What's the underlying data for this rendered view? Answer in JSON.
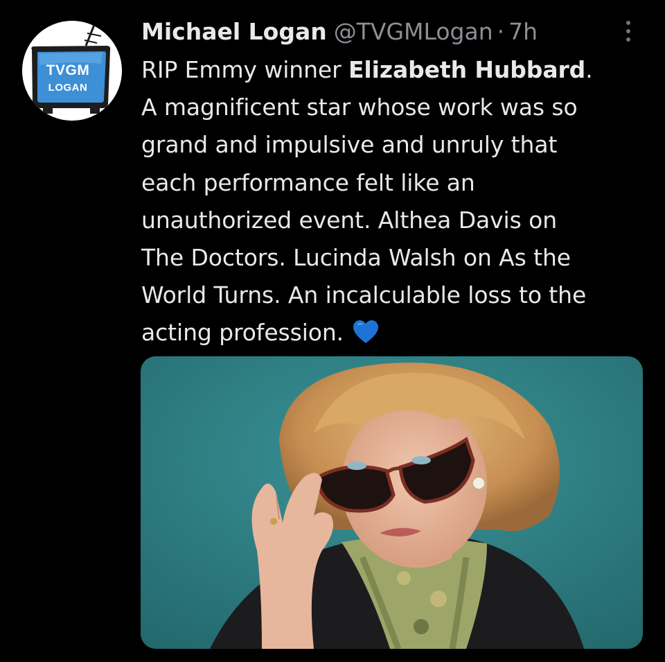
{
  "author": {
    "name": "Michael Logan",
    "handle": "@TVGMLogan",
    "separator": "·",
    "timestamp": "7h",
    "avatar_text_line1": "TVGM",
    "avatar_text_line2": "LOGAN"
  },
  "tweet": {
    "line1_prefix": "RIP Emmy winner ",
    "line1_bold": "Elizabeth Hubbard",
    "line1_suffix": ".",
    "line2": "A magnificent star whose work was so",
    "line3": "grand and impulsive and unruly that",
    "line4": "each performance felt like an",
    "line5": "unauthorized event. Althea Davis on",
    "line6": "The Doctors. Lucinda Walsh on As the",
    "line7": "World Turns. An incalculable loss to the",
    "line8": "acting profession.",
    "emoji": "blue-heart"
  },
  "media": {
    "type": "photo",
    "subject": "woman-with-sunglasses-portrait"
  },
  "icons": {
    "more": "more-vertical-icon"
  },
  "colors": {
    "background": "#000000",
    "text_primary": "#e7e9ea",
    "text_secondary": "#8b9096",
    "avatar_badge": "#3d8fd6",
    "heart": "#1d74d6",
    "photo_background": "#2f8488"
  }
}
